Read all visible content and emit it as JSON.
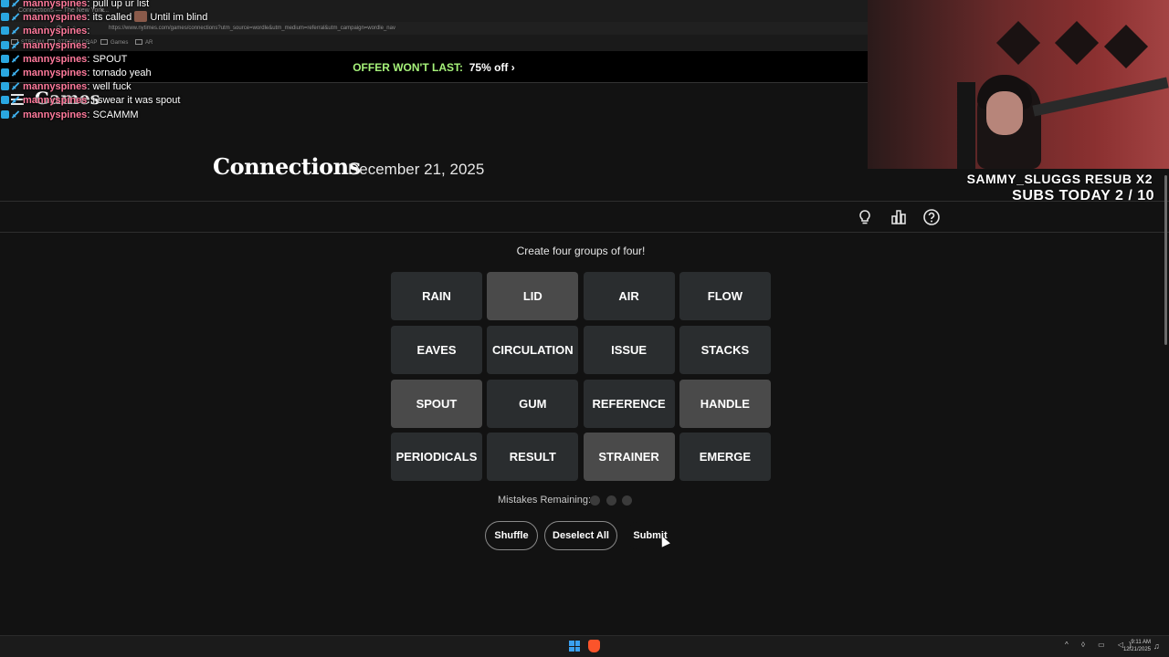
{
  "browser": {
    "tab_title": "Connections — The New York...",
    "tab_close": "×",
    "url": "https://www.nytimes.com/games/connections?utm_source=wordle&utm_medium=referral&utm_campaign=wordle_nav",
    "url_prefix": "https",
    "bookmarks": [
      "STREAM",
      "STREAM CRAP",
      "Games",
      "AR"
    ]
  },
  "offer": {
    "label": "OFFER WON'T LAST:",
    "value": "75% off",
    "arrow": "›"
  },
  "header": {
    "logo": "Games",
    "menu_icon": "hamburger-icon"
  },
  "title": {
    "name": "Connections",
    "date": "December 21, 2025"
  },
  "toolbar": {
    "icons": [
      "lightbulb-icon",
      "bar-chart-icon",
      "help-icon"
    ]
  },
  "instructions": "Create four groups of four!",
  "tiles": [
    {
      "label": "RAIN",
      "selected": false
    },
    {
      "label": "LID",
      "selected": true
    },
    {
      "label": "AIR",
      "selected": false
    },
    {
      "label": "FLOW",
      "selected": false
    },
    {
      "label": "EAVES",
      "selected": false
    },
    {
      "label": "CIRCULATION",
      "selected": false
    },
    {
      "label": "ISSUE",
      "selected": false
    },
    {
      "label": "STACKS",
      "selected": false
    },
    {
      "label": "SPOUT",
      "selected": true
    },
    {
      "label": "GUM",
      "selected": false
    },
    {
      "label": "REFERENCE",
      "selected": false
    },
    {
      "label": "HANDLE",
      "selected": true
    },
    {
      "label": "PERIODICALS",
      "selected": false
    },
    {
      "label": "RESULT",
      "selected": false
    },
    {
      "label": "STRAINER",
      "selected": true
    },
    {
      "label": "EMERGE",
      "selected": false
    }
  ],
  "mistakes": {
    "label": "Mistakes Remaining:",
    "remaining": 3
  },
  "buttons": {
    "shuffle": "Shuffle",
    "deselect": "Deselect All",
    "submit": "Submit"
  },
  "chat": [
    {
      "user": "mannyspines",
      "msg": "pull up ur list"
    },
    {
      "user": "mannyspines",
      "msg": "its called",
      "emote": true,
      "msg2": "Until im blind"
    },
    {
      "user": "mannyspines",
      "msg": ""
    },
    {
      "user": "mannyspines",
      "msg": ""
    },
    {
      "user": "mannyspines",
      "msg": "SPOUT"
    },
    {
      "user": "mannyspines",
      "msg": "tornado yeah"
    },
    {
      "user": "mannyspines",
      "msg": "well fuck"
    },
    {
      "user": "mannyspines",
      "msg": "i swear it was spout"
    },
    {
      "user": "mannyspines",
      "msg": "SCAMMM"
    }
  ],
  "overlay": {
    "line1": "SAMMY_SLUGGS RESUB X2",
    "line2": "SUBS TODAY 2 / 10"
  },
  "taskbar": {
    "time": "9:11 AM",
    "date": "12/21/2025"
  },
  "colors": {
    "tile": "#2a2d2f",
    "tile_selected": "#4a4a4a",
    "offer_green": "#a6f27a",
    "chat_user": "#ff7a9c"
  }
}
